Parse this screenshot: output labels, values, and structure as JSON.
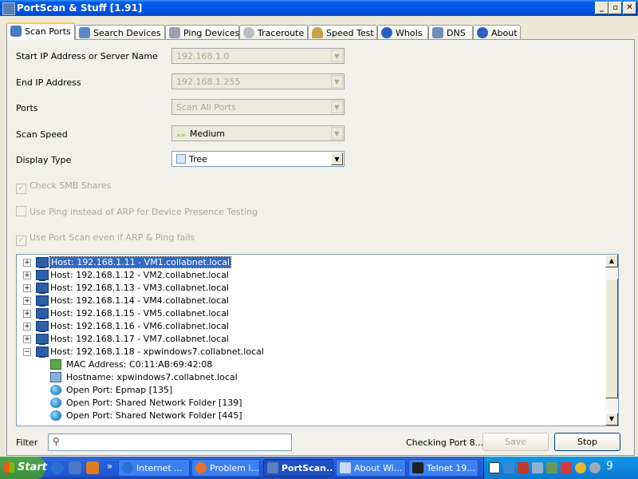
{
  "window": {
    "title": "PortScan & Stuff [1.91]",
    "controls": {
      "minimize": "_",
      "maximize": "▫",
      "close": "✕"
    }
  },
  "tabs": [
    {
      "label": "Scan Ports",
      "icon": "scan-ports-icon",
      "active": true
    },
    {
      "label": "Search Devices",
      "icon": "search-devices-icon"
    },
    {
      "label": "Ping Devices",
      "icon": "ping-devices-icon"
    },
    {
      "label": "Traceroute",
      "icon": "traceroute-icon"
    },
    {
      "label": "Speed Test",
      "icon": "speed-test-icon"
    },
    {
      "label": "WhoIs",
      "icon": "whois-icon"
    },
    {
      "label": "DNS",
      "icon": "dns-icon"
    },
    {
      "label": "About",
      "icon": "about-icon"
    }
  ],
  "form": {
    "start_ip": {
      "label": "Start IP Address or Server Name",
      "value": "192.168.1.0"
    },
    "end_ip": {
      "label": "End IP Address",
      "value": "192.168.1.255"
    },
    "ports": {
      "label": "Ports",
      "value": "Scan All Ports"
    },
    "scan_speed": {
      "label": "Scan Speed",
      "value": "Medium"
    },
    "display_type": {
      "label": "Display Type",
      "value": "Tree"
    },
    "check_smb": {
      "label": "Check SMB Shares",
      "checked": true
    },
    "use_ping": {
      "label": "Use Ping instead of ARP for Device Presence Testing",
      "checked": false
    },
    "use_port_scan": {
      "label": "Use Port Scan even if ARP & Ping fails",
      "checked": true
    }
  },
  "tree": {
    "hosts": [
      {
        "text": "Host: 192.168.1.11 - VM1.collabnet.local",
        "selected": true,
        "expanded": false
      },
      {
        "text": "Host: 192.168.1.12 - VM2.collabnet.local",
        "expanded": false
      },
      {
        "text": "Host: 192.168.1.13 - VM3.collabnet.local",
        "expanded": false
      },
      {
        "text": "Host: 192.168.1.14 - VM4.collabnet.local",
        "expanded": false
      },
      {
        "text": "Host: 192.168.1.15 - VM5.collabnet.local",
        "expanded": false
      },
      {
        "text": "Host: 192.168.1.16 - VM6.collabnet.local",
        "expanded": false
      },
      {
        "text": "Host: 192.168.1.17 - VM7.collabnet.local",
        "expanded": false
      },
      {
        "text": "Host: 192.168.1.18 - xpwindows7.collabnet.local",
        "expanded": true
      }
    ],
    "children": [
      {
        "text": "MAC Address: C0:11:AB:69:42:08",
        "icon": "mac"
      },
      {
        "text": "Hostname: xpwindows7.collabnet.local",
        "icon": "hostname"
      },
      {
        "text": "Open Port: Epmap [135]",
        "icon": "port"
      },
      {
        "text": "Open Port: Shared Network Folder [139]",
        "icon": "port"
      },
      {
        "text": "Open Port: Shared Network Folder [445]",
        "icon": "port"
      }
    ],
    "expander_collapsed": "+",
    "expander_expanded": "−"
  },
  "bottom": {
    "filter_label": "Filter",
    "filter_value": "",
    "status": "Checking Port 8...",
    "save_label": "Save",
    "stop_label": "Stop"
  },
  "taskbar": {
    "start_label": "Start",
    "chevron": "»",
    "tasks": [
      {
        "label": "Internet ...",
        "icon": "ie-icon",
        "color": "#2b6fd6"
      },
      {
        "label": "Problem l...",
        "icon": "firefox-icon",
        "color": "#e8702a"
      },
      {
        "label": "PortScan...",
        "icon": "portscan-icon",
        "color": "#5a7fb8",
        "active": true
      },
      {
        "label": "About Wi...",
        "icon": "window-icon",
        "color": "#c8d6ee"
      },
      {
        "label": "Telnet 19...",
        "icon": "console-icon",
        "color": "#222222"
      }
    ],
    "clock": "9"
  }
}
